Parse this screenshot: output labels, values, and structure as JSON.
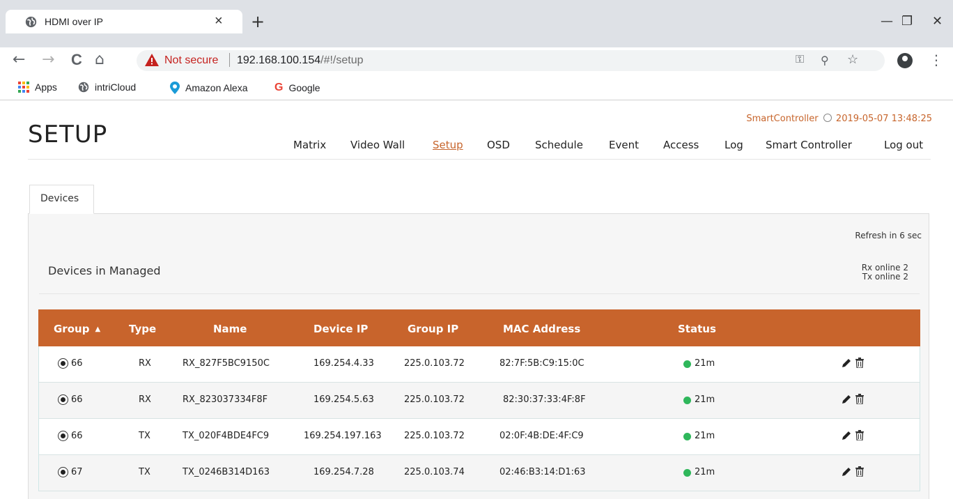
{
  "browser": {
    "tab_title": "HDMI over IP",
    "tab_close": "×",
    "new_tab": "+",
    "window_controls": {
      "minimize": "—",
      "restore": "❐",
      "close": "✕"
    },
    "nav": {
      "back": "←",
      "forward": "→",
      "reload": "C",
      "home": "⌂"
    },
    "address": {
      "security_label": "Not secure",
      "host": "192.168.100.154",
      "path": "/#!/setup"
    },
    "omnibox_icons": {
      "key": "⚿",
      "zoom": "⚲",
      "star": "☆"
    },
    "menu": "⋮",
    "bookmarks": [
      {
        "label": "Apps",
        "icon": "apps-grid-icon"
      },
      {
        "label": "intriCloud",
        "icon": "globe-icon"
      },
      {
        "label": "Amazon Alexa",
        "icon": "location-pin-icon"
      },
      {
        "label": "Google",
        "icon": "google-g-icon"
      }
    ],
    "colors": {
      "not_secure": "#c5221f"
    }
  },
  "header": {
    "brand": "SmartController",
    "datetime": "2019-05-07 13:48:25",
    "title": "SETUP",
    "nav": [
      "Matrix",
      "Video Wall",
      "Setup",
      "OSD",
      "Schedule",
      "Event",
      "Access",
      "Log",
      "Smart Controller",
      "Log out"
    ],
    "active_nav": "Setup"
  },
  "tabs": {
    "devices": "Devices"
  },
  "devices": {
    "refresh_text": "Refresh in 6 sec",
    "section_title": "Devices in Managed",
    "rx_online": "Rx online 2",
    "tx_online": "Tx online 2",
    "columns": [
      "Group",
      "Type",
      "Name",
      "Device IP",
      "Group IP",
      "MAC Address",
      "Status"
    ],
    "sort_indicator": "▲",
    "rows": [
      {
        "group": "66",
        "type": "RX",
        "name": "RX_827F5BC9150C",
        "device_ip": "169.254.4.33",
        "group_ip": "225.0.103.72",
        "mac": "82:7F:5B:C9:15:0C",
        "status": "21m"
      },
      {
        "group": "66",
        "type": "RX",
        "name": "RX_823037334F8F",
        "device_ip": "169.254.5.63",
        "group_ip": "225.0.103.72",
        "mac": "82:30:37:33:4F:8F",
        "status": "21m"
      },
      {
        "group": "66",
        "type": "TX",
        "name": "TX_020F4BDE4FC9",
        "device_ip": "169.254.197.163",
        "group_ip": "225.0.103.72",
        "mac": "02:0F:4B:DE:4F:C9",
        "status": "21m"
      },
      {
        "group": "67",
        "type": "TX",
        "name": "TX_0246B314D163",
        "device_ip": "169.254.7.28",
        "group_ip": "225.0.103.74",
        "mac": "02:46:B3:14:D1:63",
        "status": "21m"
      }
    ],
    "colors": {
      "header_bg": "#c8642c",
      "accent": "#c7652c",
      "online": "#2fb75b"
    }
  }
}
